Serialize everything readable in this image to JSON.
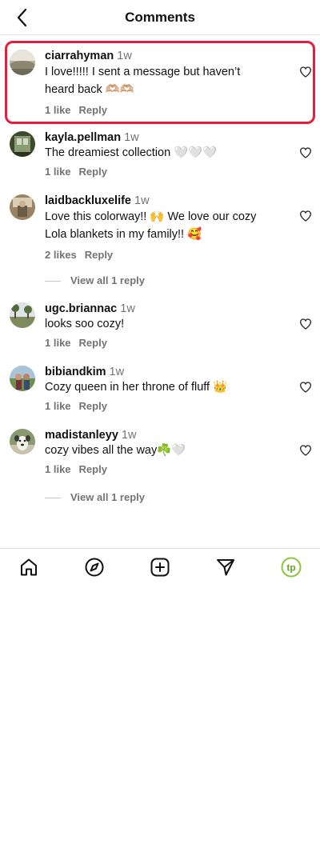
{
  "header": {
    "title": "Comments"
  },
  "comments": [
    {
      "username": "ciarrahyman",
      "time": "1w",
      "lines": [
        "I love!!!!! I sent a message but haven’t",
        "heard back 🫶🏼🫶🏼"
      ],
      "likes": "1 like",
      "reply": "Reply"
    },
    {
      "username": "kayla.pellman",
      "time": "1w",
      "lines": [
        "The dreamiest collection 🤍🤍🤍"
      ],
      "likes": "1 like",
      "reply": "Reply"
    },
    {
      "username": "laidbackluxelife",
      "time": "1w",
      "lines": [
        "Love this colorway!! 🙌 We love our cozy",
        "Lola blankets in my family!! 🥰"
      ],
      "likes": "2 likes",
      "reply": "Reply",
      "view_replies": "View all 1 reply"
    },
    {
      "username": "ugc.briannac",
      "time": "1w",
      "lines": [
        "looks soo cozy!"
      ],
      "likes": "1 like",
      "reply": "Reply"
    },
    {
      "username": "bibiandkim",
      "time": "1w",
      "lines": [
        "Cozy queen in her throne of fluff 👑"
      ],
      "likes": "1 like",
      "reply": "Reply"
    },
    {
      "username": "madistanleyy",
      "time": "1w",
      "lines": [
        "cozy vibes all the way☘️🤍"
      ],
      "likes": "1 like",
      "reply": "Reply",
      "view_replies": "View all 1 reply"
    }
  ],
  "tabbar": {
    "icons": [
      "home-icon",
      "explore-compass-icon",
      "create-plus-icon",
      "direct-send-icon",
      "profile-avatar"
    ],
    "profile_initials": "tp",
    "profile_color": "#8dc63f"
  },
  "colors": {
    "highlight": "#e31d3b",
    "muted": "#737373"
  }
}
